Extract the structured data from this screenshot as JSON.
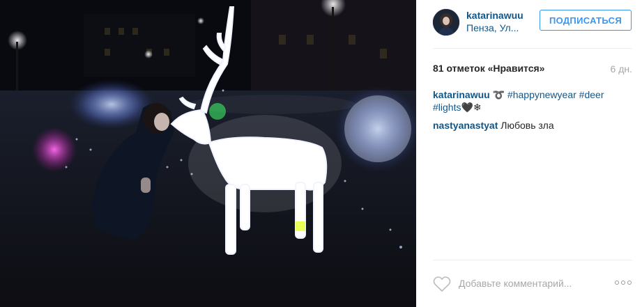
{
  "post": {
    "username": "katarinawuu",
    "location": "Пенза, Ул...",
    "follow_label": "ПОДПИСАТЬСЯ",
    "likes_text": "81 отметок «Нравится»",
    "time_ago": "6 дн.",
    "caption": {
      "user": "katarinawuu",
      "emoji": "➰",
      "tags": [
        "#happynewyear",
        "#deer",
        "#lights"
      ],
      "trailing": "🖤❄"
    },
    "comments": [
      {
        "user": "nastyanastyat",
        "text": "Любовь зла"
      }
    ],
    "comment_placeholder": "Добавьте комментарий...",
    "more_label": "..."
  },
  "colors": {
    "link": "#125688",
    "follow": "#3897f0",
    "muted": "#a5a7aa"
  },
  "icons": {
    "like": "heart-outline-icon",
    "more": "ellipsis-icon"
  }
}
